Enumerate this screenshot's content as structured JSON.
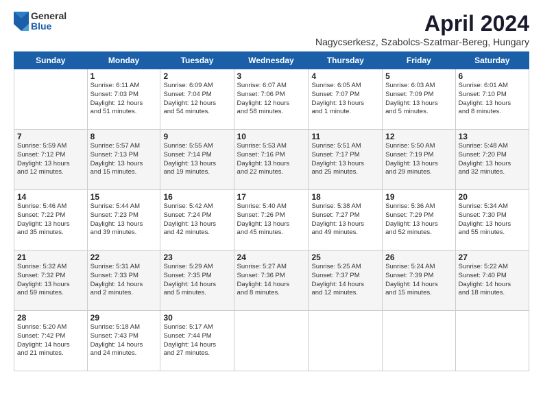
{
  "logo": {
    "general": "General",
    "blue": "Blue"
  },
  "title": "April 2024",
  "location": "Nagycserkesz, Szabolcs-Szatmar-Bereg, Hungary",
  "days_of_week": [
    "Sunday",
    "Monday",
    "Tuesday",
    "Wednesday",
    "Thursday",
    "Friday",
    "Saturday"
  ],
  "weeks": [
    [
      {
        "day": "",
        "info": ""
      },
      {
        "day": "1",
        "info": "Sunrise: 6:11 AM\nSunset: 7:03 PM\nDaylight: 12 hours\nand 51 minutes."
      },
      {
        "day": "2",
        "info": "Sunrise: 6:09 AM\nSunset: 7:04 PM\nDaylight: 12 hours\nand 54 minutes."
      },
      {
        "day": "3",
        "info": "Sunrise: 6:07 AM\nSunset: 7:06 PM\nDaylight: 12 hours\nand 58 minutes."
      },
      {
        "day": "4",
        "info": "Sunrise: 6:05 AM\nSunset: 7:07 PM\nDaylight: 13 hours\nand 1 minute."
      },
      {
        "day": "5",
        "info": "Sunrise: 6:03 AM\nSunset: 7:09 PM\nDaylight: 13 hours\nand 5 minutes."
      },
      {
        "day": "6",
        "info": "Sunrise: 6:01 AM\nSunset: 7:10 PM\nDaylight: 13 hours\nand 8 minutes."
      }
    ],
    [
      {
        "day": "7",
        "info": "Sunrise: 5:59 AM\nSunset: 7:12 PM\nDaylight: 13 hours\nand 12 minutes."
      },
      {
        "day": "8",
        "info": "Sunrise: 5:57 AM\nSunset: 7:13 PM\nDaylight: 13 hours\nand 15 minutes."
      },
      {
        "day": "9",
        "info": "Sunrise: 5:55 AM\nSunset: 7:14 PM\nDaylight: 13 hours\nand 19 minutes."
      },
      {
        "day": "10",
        "info": "Sunrise: 5:53 AM\nSunset: 7:16 PM\nDaylight: 13 hours\nand 22 minutes."
      },
      {
        "day": "11",
        "info": "Sunrise: 5:51 AM\nSunset: 7:17 PM\nDaylight: 13 hours\nand 25 minutes."
      },
      {
        "day": "12",
        "info": "Sunrise: 5:50 AM\nSunset: 7:19 PM\nDaylight: 13 hours\nand 29 minutes."
      },
      {
        "day": "13",
        "info": "Sunrise: 5:48 AM\nSunset: 7:20 PM\nDaylight: 13 hours\nand 32 minutes."
      }
    ],
    [
      {
        "day": "14",
        "info": "Sunrise: 5:46 AM\nSunset: 7:22 PM\nDaylight: 13 hours\nand 35 minutes."
      },
      {
        "day": "15",
        "info": "Sunrise: 5:44 AM\nSunset: 7:23 PM\nDaylight: 13 hours\nand 39 minutes."
      },
      {
        "day": "16",
        "info": "Sunrise: 5:42 AM\nSunset: 7:24 PM\nDaylight: 13 hours\nand 42 minutes."
      },
      {
        "day": "17",
        "info": "Sunrise: 5:40 AM\nSunset: 7:26 PM\nDaylight: 13 hours\nand 45 minutes."
      },
      {
        "day": "18",
        "info": "Sunrise: 5:38 AM\nSunset: 7:27 PM\nDaylight: 13 hours\nand 49 minutes."
      },
      {
        "day": "19",
        "info": "Sunrise: 5:36 AM\nSunset: 7:29 PM\nDaylight: 13 hours\nand 52 minutes."
      },
      {
        "day": "20",
        "info": "Sunrise: 5:34 AM\nSunset: 7:30 PM\nDaylight: 13 hours\nand 55 minutes."
      }
    ],
    [
      {
        "day": "21",
        "info": "Sunrise: 5:32 AM\nSunset: 7:32 PM\nDaylight: 13 hours\nand 59 minutes."
      },
      {
        "day": "22",
        "info": "Sunrise: 5:31 AM\nSunset: 7:33 PM\nDaylight: 14 hours\nand 2 minutes."
      },
      {
        "day": "23",
        "info": "Sunrise: 5:29 AM\nSunset: 7:35 PM\nDaylight: 14 hours\nand 5 minutes."
      },
      {
        "day": "24",
        "info": "Sunrise: 5:27 AM\nSunset: 7:36 PM\nDaylight: 14 hours\nand 8 minutes."
      },
      {
        "day": "25",
        "info": "Sunrise: 5:25 AM\nSunset: 7:37 PM\nDaylight: 14 hours\nand 12 minutes."
      },
      {
        "day": "26",
        "info": "Sunrise: 5:24 AM\nSunset: 7:39 PM\nDaylight: 14 hours\nand 15 minutes."
      },
      {
        "day": "27",
        "info": "Sunrise: 5:22 AM\nSunset: 7:40 PM\nDaylight: 14 hours\nand 18 minutes."
      }
    ],
    [
      {
        "day": "28",
        "info": "Sunrise: 5:20 AM\nSunset: 7:42 PM\nDaylight: 14 hours\nand 21 minutes."
      },
      {
        "day": "29",
        "info": "Sunrise: 5:18 AM\nSunset: 7:43 PM\nDaylight: 14 hours\nand 24 minutes."
      },
      {
        "day": "30",
        "info": "Sunrise: 5:17 AM\nSunset: 7:44 PM\nDaylight: 14 hours\nand 27 minutes."
      },
      {
        "day": "",
        "info": ""
      },
      {
        "day": "",
        "info": ""
      },
      {
        "day": "",
        "info": ""
      },
      {
        "day": "",
        "info": ""
      }
    ]
  ]
}
